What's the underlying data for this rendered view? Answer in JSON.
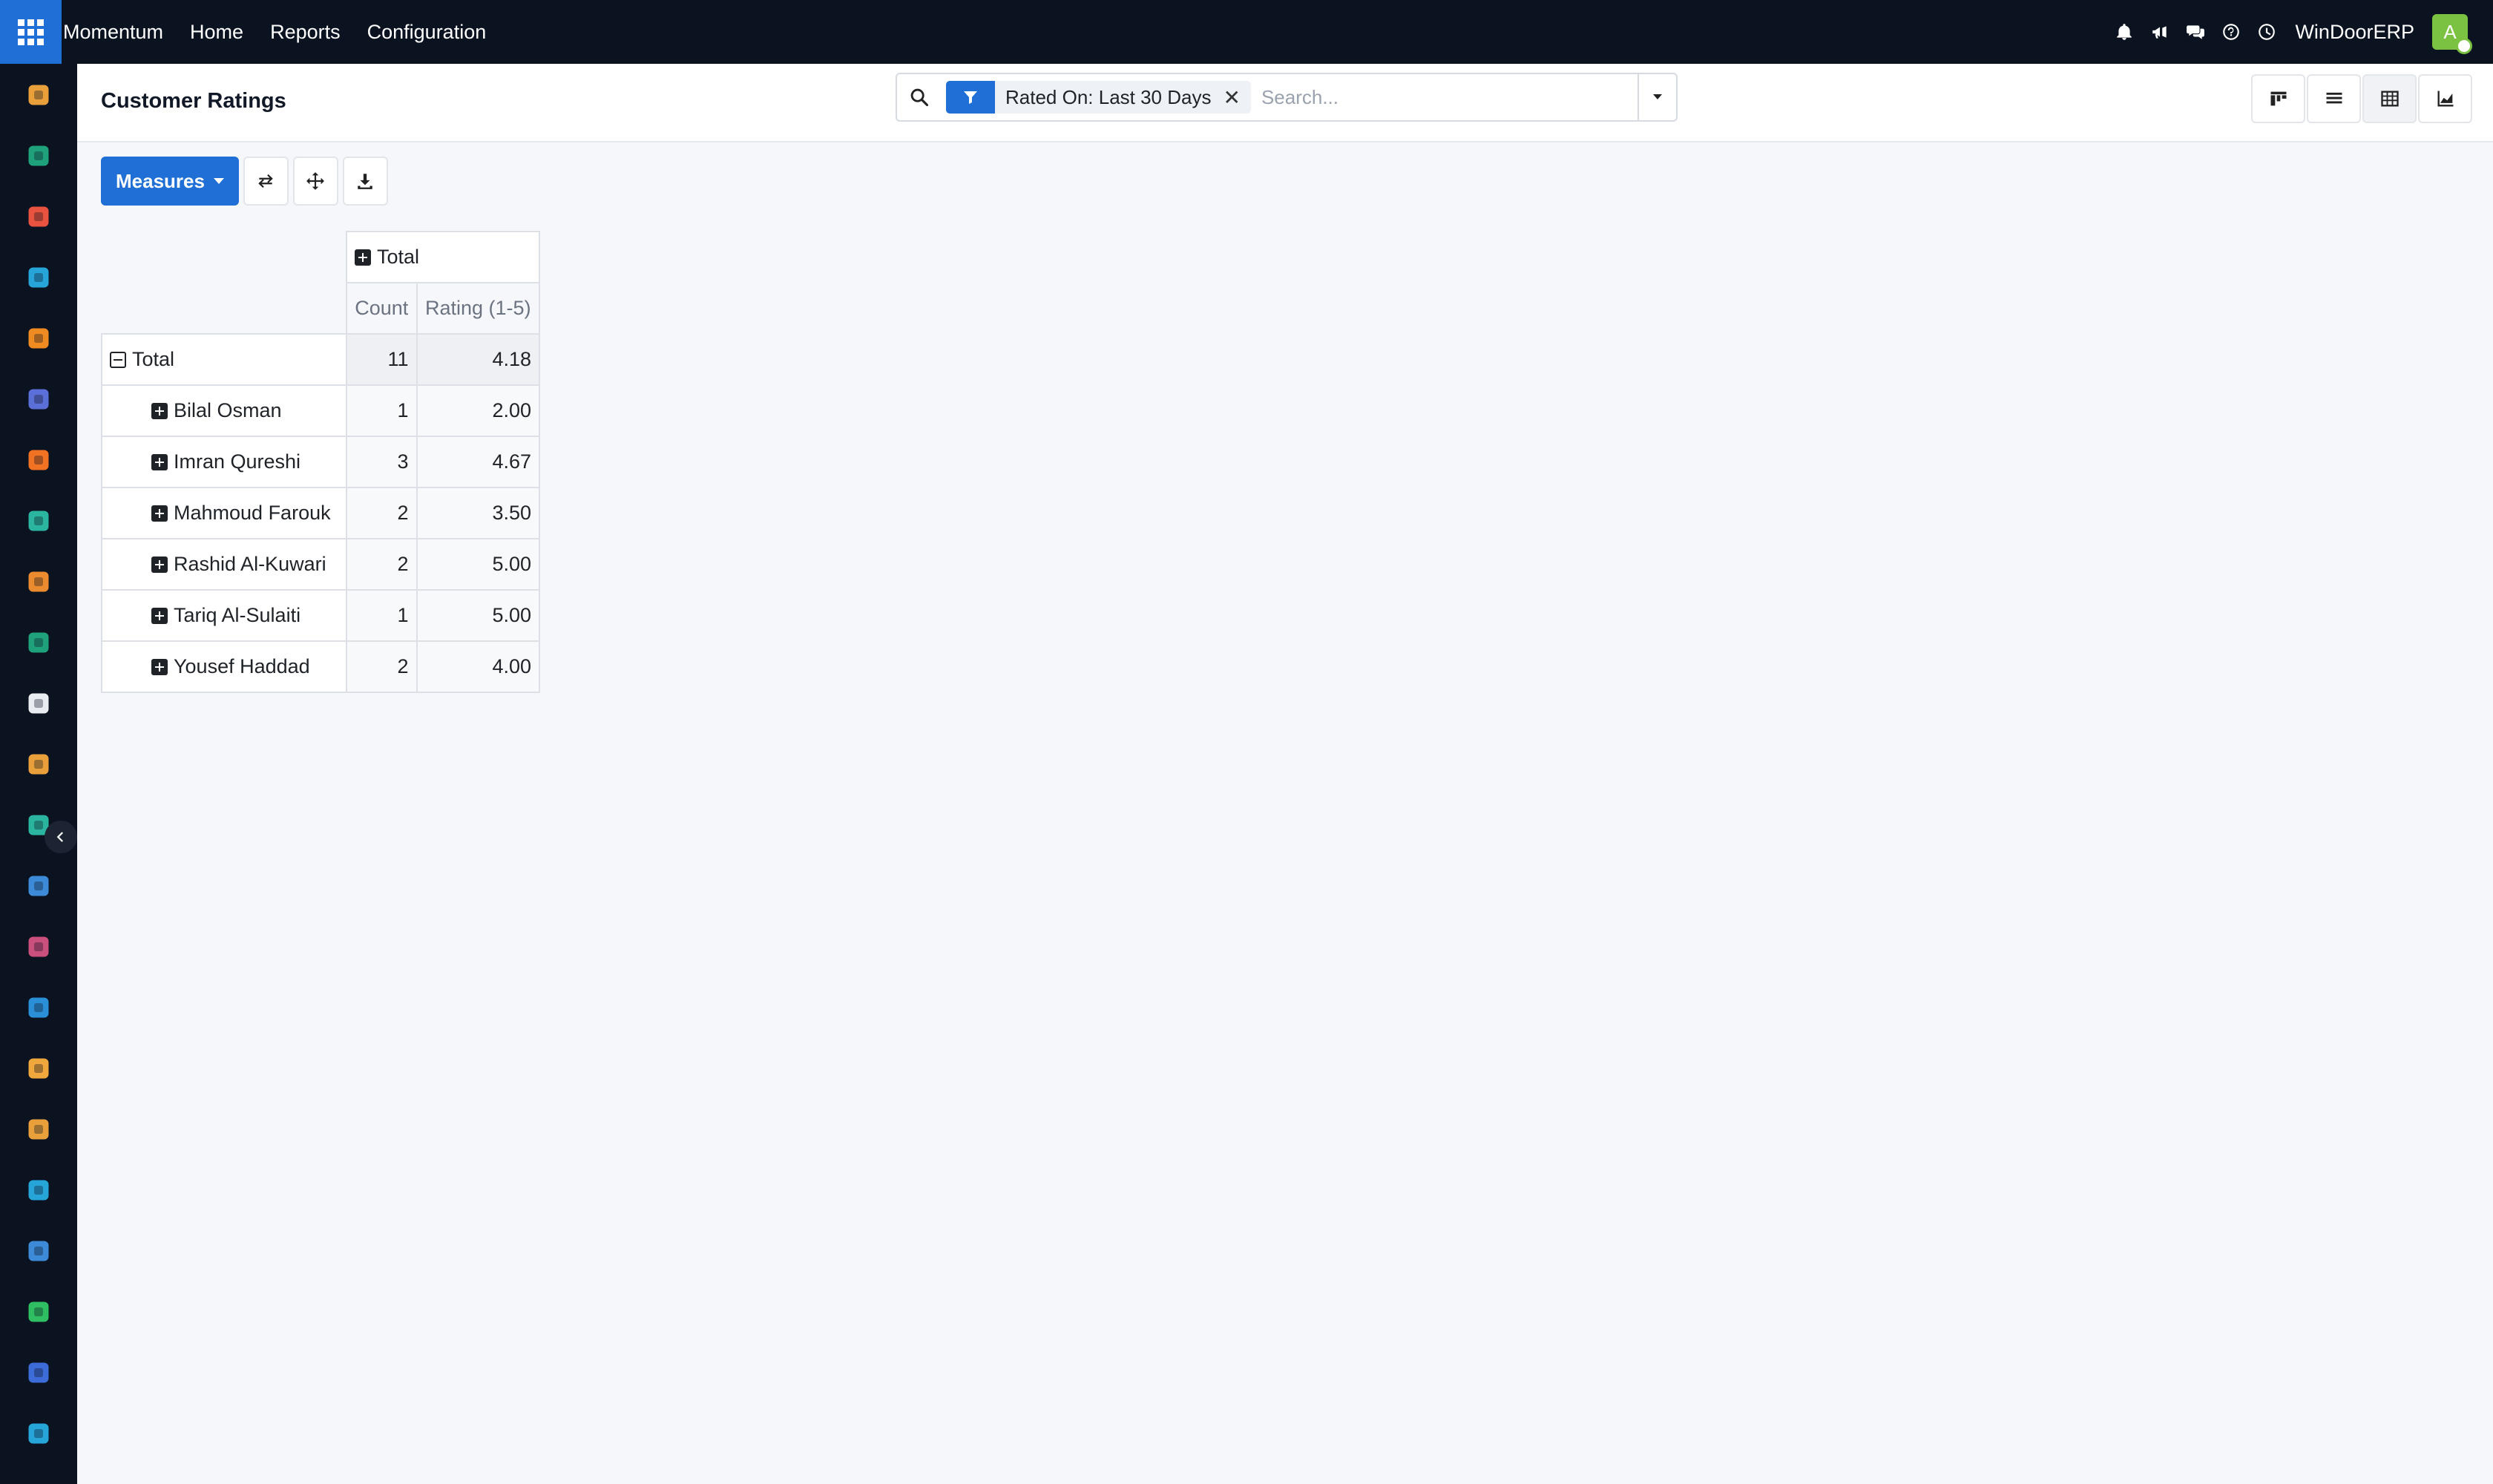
{
  "navbar": {
    "brand": "Momentum",
    "menu": [
      "Home",
      "Reports",
      "Configuration"
    ],
    "company": "WinDoorERP",
    "avatar_letter": "A",
    "icons": [
      "bell-icon",
      "megaphone-icon",
      "chat-icon",
      "help-icon",
      "clock-icon"
    ]
  },
  "sidebar": {
    "apps": [
      {
        "icon": "discuss-app-icon",
        "color": "#e9a03b"
      },
      {
        "icon": "contacts-app-icon",
        "color": "#1fa27c"
      },
      {
        "icon": "reports-app-icon",
        "color": "#e7533e"
      },
      {
        "icon": "pie-app-icon",
        "color": "#27a4d8"
      },
      {
        "icon": "chat-app-icon",
        "color": "#f08b22"
      },
      {
        "icon": "mail-app-icon",
        "color": "#5b6fd8"
      },
      {
        "icon": "helpdesk-app-icon",
        "color": "#f07222"
      },
      {
        "icon": "projects-app-icon",
        "color": "#2bb5a0"
      },
      {
        "icon": "sales-app-icon",
        "color": "#e98b2e"
      },
      {
        "icon": "employees-app-icon",
        "color": "#1fa27c"
      },
      {
        "icon": "inventory-app-icon",
        "color": "#e9ecf1"
      },
      {
        "icon": "settings-app-icon",
        "color": "#e9a03b"
      },
      {
        "icon": "tasks-app-icon",
        "color": "#2bb5a0"
      },
      {
        "icon": "knowledge-app-icon",
        "color": "#3d8bd8"
      },
      {
        "icon": "packages-app-icon",
        "color": "#c94f7c"
      },
      {
        "icon": "invoicing-app-icon",
        "color": "#2b8fd8"
      },
      {
        "icon": "team-app-icon",
        "color": "#f0a73b"
      },
      {
        "icon": "calendar-app-icon",
        "color": "#e9a03b"
      },
      {
        "icon": "sign-app-icon",
        "color": "#27a4d8"
      },
      {
        "icon": "dashboard-app-icon",
        "color": "#3d8bd8"
      },
      {
        "icon": "whatsapp-app-icon",
        "color": "#2fbf62"
      },
      {
        "icon": "clock-app-icon",
        "color": "#3d6bd8"
      },
      {
        "icon": "website-app-icon",
        "color": "#27a4d8"
      }
    ]
  },
  "control_panel": {
    "title": "Customer Ratings",
    "facet_label": "Rated On: Last 30 Days",
    "search_placeholder": "Search...",
    "views": [
      "kanban-view-icon",
      "list-view-icon",
      "pivot-view-icon",
      "graph-view-icon"
    ]
  },
  "toolbar": {
    "measures_label": "Measures"
  },
  "pivot": {
    "col_header": "Total",
    "measures": [
      "Count",
      "Rating (1-5)"
    ],
    "total_row": {
      "label": "Total",
      "count": "11",
      "rating": "4.18"
    },
    "rows": [
      {
        "label": "Bilal Osman",
        "count": "1",
        "rating": "2.00"
      },
      {
        "label": "Imran Qureshi",
        "count": "3",
        "rating": "4.67"
      },
      {
        "label": "Mahmoud Farouk",
        "count": "2",
        "rating": "3.50"
      },
      {
        "label": "Rashid Al-Kuwari",
        "count": "2",
        "rating": "5.00"
      },
      {
        "label": "Tariq Al-Sulaiti",
        "count": "1",
        "rating": "5.00"
      },
      {
        "label": "Yousef Haddad",
        "count": "2",
        "rating": "4.00"
      }
    ]
  }
}
